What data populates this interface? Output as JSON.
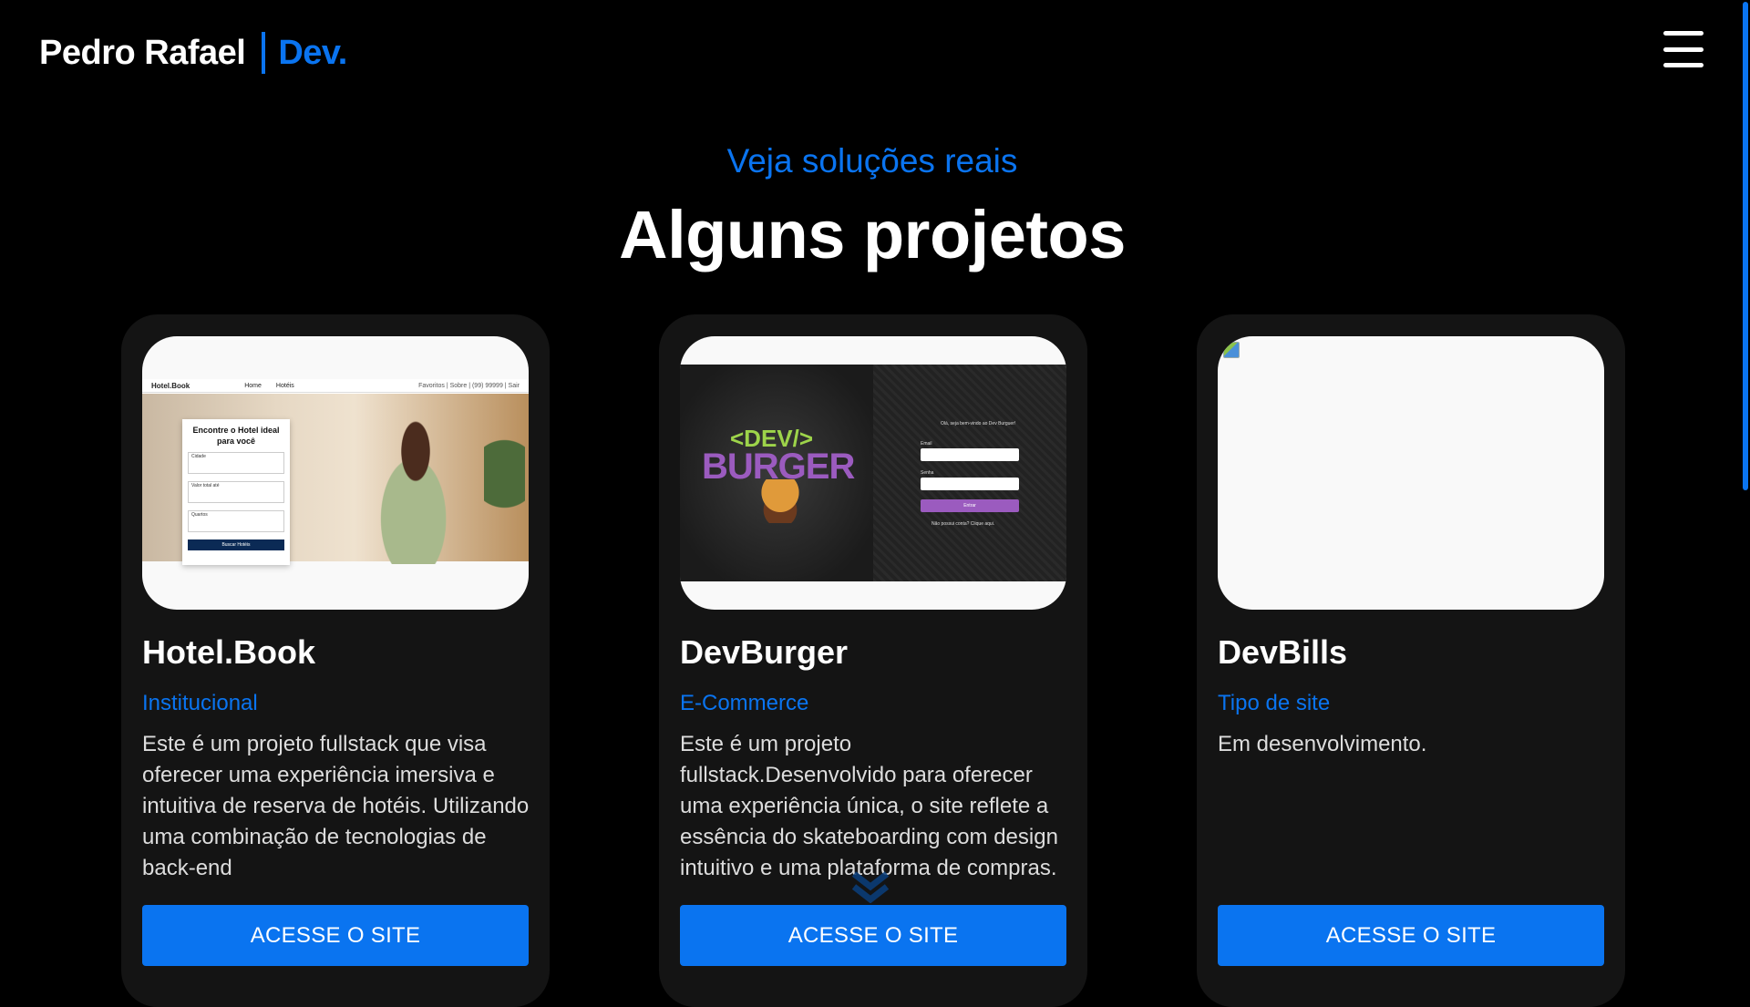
{
  "header": {
    "logo_name": "Pedro Rafael",
    "logo_suffix": "Dev.",
    "menu_icon": "hamburger-menu-icon"
  },
  "section": {
    "subtitle": "Veja soluções reais",
    "title": "Alguns projetos"
  },
  "projects": [
    {
      "title": "Hotel.Book",
      "type": "Institucional",
      "description": "Este é um projeto fullstack que visa oferecer uma experiência imersiva e intuitiva de reserva de hotéis. Utilizando uma combinação de tecnologias de back-end",
      "cta": "ACESSE O SITE",
      "screenshot": {
        "nav_brand": "Hotel.Book",
        "nav_links": [
          "Home",
          "Hotéis"
        ],
        "nav_right": "Favoritos | Sobre | (99) 99999 | Sair",
        "form_title": "Encontre o Hotel ideal para você",
        "fields": [
          "Cidade",
          "Valor total até",
          "Quartos"
        ],
        "button": "Buscar Hotéis"
      }
    },
    {
      "title": "DevBurger",
      "type": "E-Commerce",
      "description": "Este é um projeto fullstack.Desenvolvido para oferecer uma experiência única, o site reflete a essência do skateboarding com design intuitivo e uma plataforma de compras.",
      "cta": "ACESSE O SITE",
      "screenshot": {
        "logo_top": "<DEV/>",
        "logo_bottom": "BURGER",
        "welcome": "Olá, seja bem-vindo ao Dev Burguer!",
        "email_label": "Email",
        "password_label": "Senha",
        "button": "Entrar",
        "footer": "Não possui conta? Clique aqui."
      }
    },
    {
      "title": "DevBills",
      "type": "Tipo de site",
      "description": "Em desenvolvimento.",
      "cta": "ACESSE O SITE"
    }
  ],
  "colors": {
    "accent": "#0a74f0",
    "background": "#000000",
    "card": "#141414"
  }
}
